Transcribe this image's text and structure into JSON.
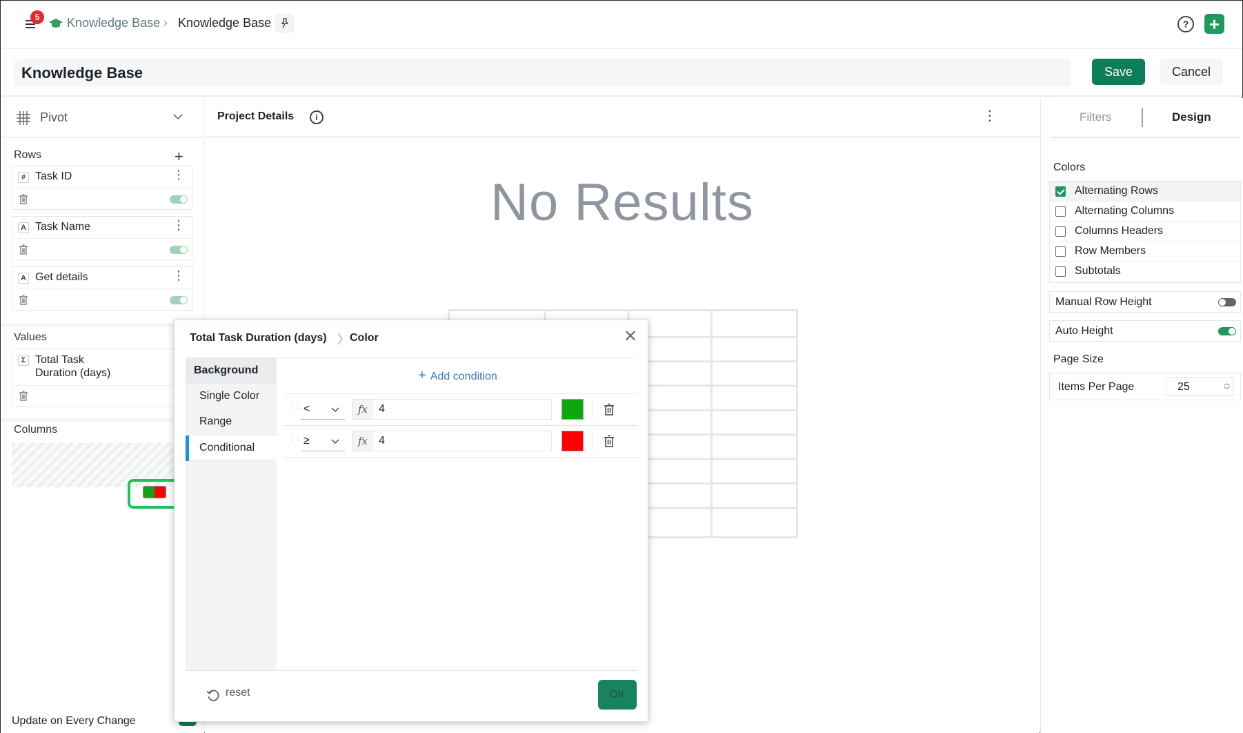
{
  "header": {
    "notification_count": "5",
    "breadcrumb_link": "Knowledge Base",
    "breadcrumb_separator": "›",
    "breadcrumb_current": "Knowledge Base",
    "help_label": "?",
    "add_label": "+"
  },
  "titlebar": {
    "title": "Knowledge Base",
    "save_label": "Save",
    "cancel_label": "Cancel"
  },
  "left": {
    "visualization": "Pivot",
    "rows_label": "Rows",
    "rows": [
      {
        "type": "#",
        "name": "Task ID"
      },
      {
        "type": "A",
        "name": "Task Name"
      },
      {
        "type": "A",
        "name": "Get details"
      }
    ],
    "values_label": "Values",
    "values": [
      {
        "type": "Σ",
        "name": "Total Task Duration (days)"
      }
    ],
    "columns_label": "Columns",
    "update_label": "Update on Every Change"
  },
  "center": {
    "widget_title": "Project Details",
    "empty_message": "No Results"
  },
  "right": {
    "tab_filters": "Filters",
    "tab_design": "Design",
    "colors_label": "Colors",
    "color_options": [
      {
        "label": "Alternating Rows",
        "checked": true
      },
      {
        "label": "Alternating Columns",
        "checked": false
      },
      {
        "label": "Columns Headers",
        "checked": false
      },
      {
        "label": "Row Members",
        "checked": false
      },
      {
        "label": "Subtotals",
        "checked": false
      }
    ],
    "manual_row_height": "Manual Row Height",
    "auto_height": "Auto Height",
    "page_size_label": "Page Size",
    "items_per_page_label": "Items Per Page",
    "items_per_page_value": "25"
  },
  "modal": {
    "title": "Total Task Duration (days)",
    "breadcrumb_sep": "〉",
    "subtitle": "Color",
    "nav_header": "Background",
    "nav_items": [
      "Single Color",
      "Range",
      "Conditional"
    ],
    "add_condition": "Add condition",
    "conditions": [
      {
        "operator": "<",
        "value": "4",
        "color": "#0ea80e"
      },
      {
        "operator": "≥",
        "value": "4",
        "color": "#ff0000"
      }
    ],
    "fx_label": "fx",
    "reset_label": "reset",
    "ok_label": "OK"
  },
  "colors": {
    "brand_green": "#0c7c59",
    "accent_blue": "#1a90e0",
    "highlight_green": "#19c65a"
  }
}
